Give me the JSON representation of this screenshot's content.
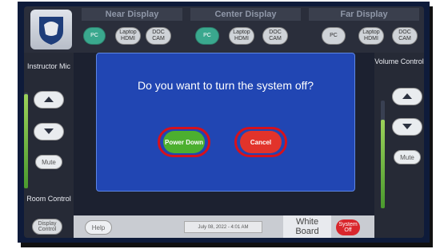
{
  "topbar": {
    "displays": [
      "Near Display",
      "Center Display",
      "Far Display"
    ],
    "sources": [
      "PC",
      "Laptop HDMI",
      "DOC CAM"
    ]
  },
  "left": {
    "instructor_mic": "Instructor Mic",
    "mute": "Mute",
    "room_control": "Room Control",
    "display_control": "Display Control"
  },
  "right": {
    "volume_control": "Volume Control",
    "mute": "Mute"
  },
  "dialog": {
    "question": "Do you want to turn the system off?",
    "power_down": "Power Down",
    "cancel": "Cancel"
  },
  "bottom": {
    "help": "Help",
    "datetime": "July 08, 2022  -  4:01 AM",
    "white_board": "White Board",
    "system_off": "System Off"
  },
  "colors": {
    "dialog_bg": "#2146b3",
    "active_source": "#3aa88e",
    "power_down": "#4caf2f",
    "cancel": "#e2332b",
    "highlight_ring": "#d6111c"
  },
  "icons": [
    "shield-logo-icon",
    "up-arrow-icon",
    "down-arrow-icon"
  ]
}
